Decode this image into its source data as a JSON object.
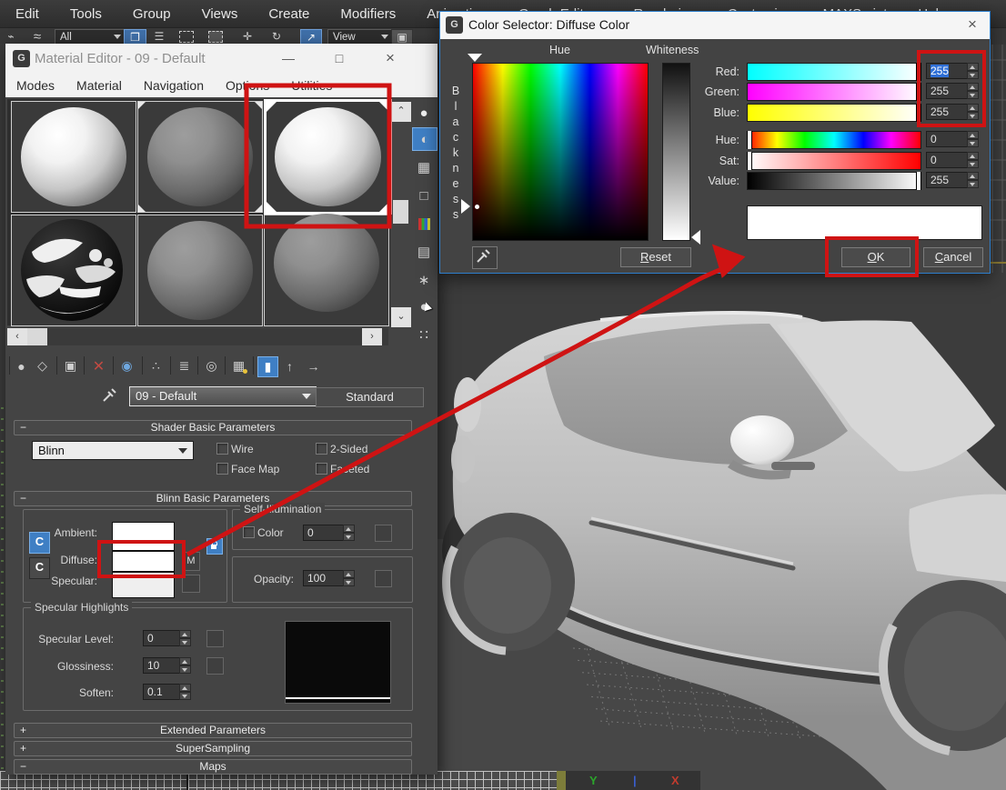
{
  "menubar": {
    "items": [
      "Edit",
      "Tools",
      "Group",
      "Views",
      "Create",
      "Modifiers",
      "Animation",
      "Graph Editors",
      "Rendering",
      "Customize",
      "MAXScript",
      "Help"
    ]
  },
  "main_toolbar": {
    "selection_filter_value": "All",
    "coordinate_system_value": "View"
  },
  "material_editor": {
    "title": "Material Editor - 09 - Default",
    "menu_items": [
      "Modes",
      "Material",
      "Navigation",
      "Options",
      "Utilities"
    ],
    "material_name": "09 - Default",
    "type_button": "Standard",
    "shader_rollout": {
      "title": "Shader Basic Parameters",
      "shader": "Blinn",
      "wire": "Wire",
      "two_sided": "2-Sided",
      "face_map": "Face Map",
      "faceted": "Faceted"
    },
    "blinn_rollout": {
      "title": "Blinn Basic Parameters",
      "ambient": "Ambient:",
      "diffuse": "Diffuse:",
      "specular": "Specular:",
      "map_btn": "M",
      "self_illumination": {
        "title": "Self-Illumination",
        "color": "Color",
        "value": "0"
      },
      "opacity": {
        "label": "Opacity:",
        "value": "100"
      }
    },
    "specular_highlights": {
      "title": "Specular Highlights",
      "specular_level_label": "Specular Level:",
      "specular_level": "0",
      "glossiness_label": "Glossiness:",
      "glossiness": "10",
      "soften_label": "Soften:",
      "soften": "0.1"
    },
    "rollouts": {
      "extended": "Extended Parameters",
      "supersampling": "SuperSampling",
      "maps": "Maps",
      "collapsed_glyph": "+",
      "expanded_glyph": "−"
    }
  },
  "color_selector": {
    "title": "Color Selector: Diffuse Color",
    "hue_label": "Hue",
    "whiteness_label": "Whiteness",
    "blackness_label": "Blackness",
    "red_label": "Red:",
    "red_value": "255",
    "green_label": "Green:",
    "green_value": "255",
    "blue_label": "Blue:",
    "blue_value": "255",
    "hue2_label": "Hue:",
    "hue_value": "0",
    "sat_label": "Sat:",
    "sat_value": "0",
    "value_label": "Value:",
    "value_value": "255",
    "reset": "Reset",
    "ok": "OK",
    "cancel": "Cancel"
  },
  "viewport": {
    "axis_y": "Y",
    "axis_x": "X"
  },
  "colors": {
    "annotation_red": "#cf1313",
    "selection_blue": "#2f6fd6",
    "active_blue": "#3f7fc4",
    "dialog_border": "#2e7ecb"
  }
}
